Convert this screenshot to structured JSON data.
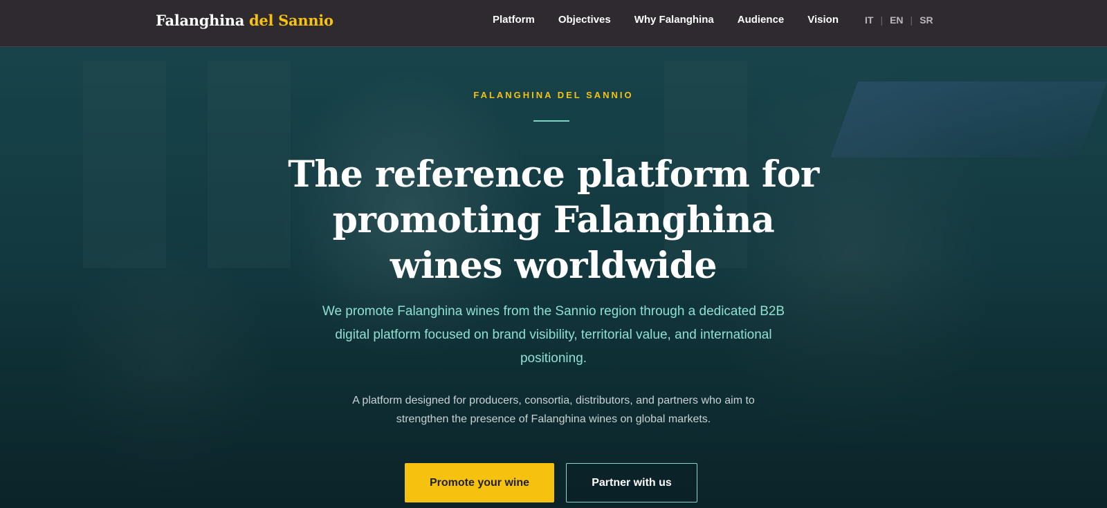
{
  "brand": {
    "name_part1": "Falanghina",
    "name_part2": "del Sannio"
  },
  "nav": {
    "links": [
      "Platform",
      "Objectives",
      "Why Falanghina",
      "Audience",
      "Vision"
    ],
    "languages": [
      "IT",
      "EN",
      "SR"
    ],
    "separator": "|"
  },
  "hero": {
    "eyebrow": "FALANGHINA DEL SANNIO",
    "headline": "The reference platform for promoting Falanghina wines worldwide",
    "lead": "We promote Falanghina wines from the Sannio region through a dedicated B2B digital platform focused on brand visibility, territorial value, and international positioning.",
    "sub": "A platform designed for producers, consortia, distributors, and partners who aim to strengthen the presence of Falanghina wines on global markets.",
    "cta_primary": "Promote your wine",
    "cta_secondary": "Partner with us"
  },
  "colors": {
    "nav_background": "#2f2a2f",
    "accent_gold": "#f6c20f",
    "accent_teal": "#8fe0d3",
    "hero_overlay": "#173f47"
  }
}
